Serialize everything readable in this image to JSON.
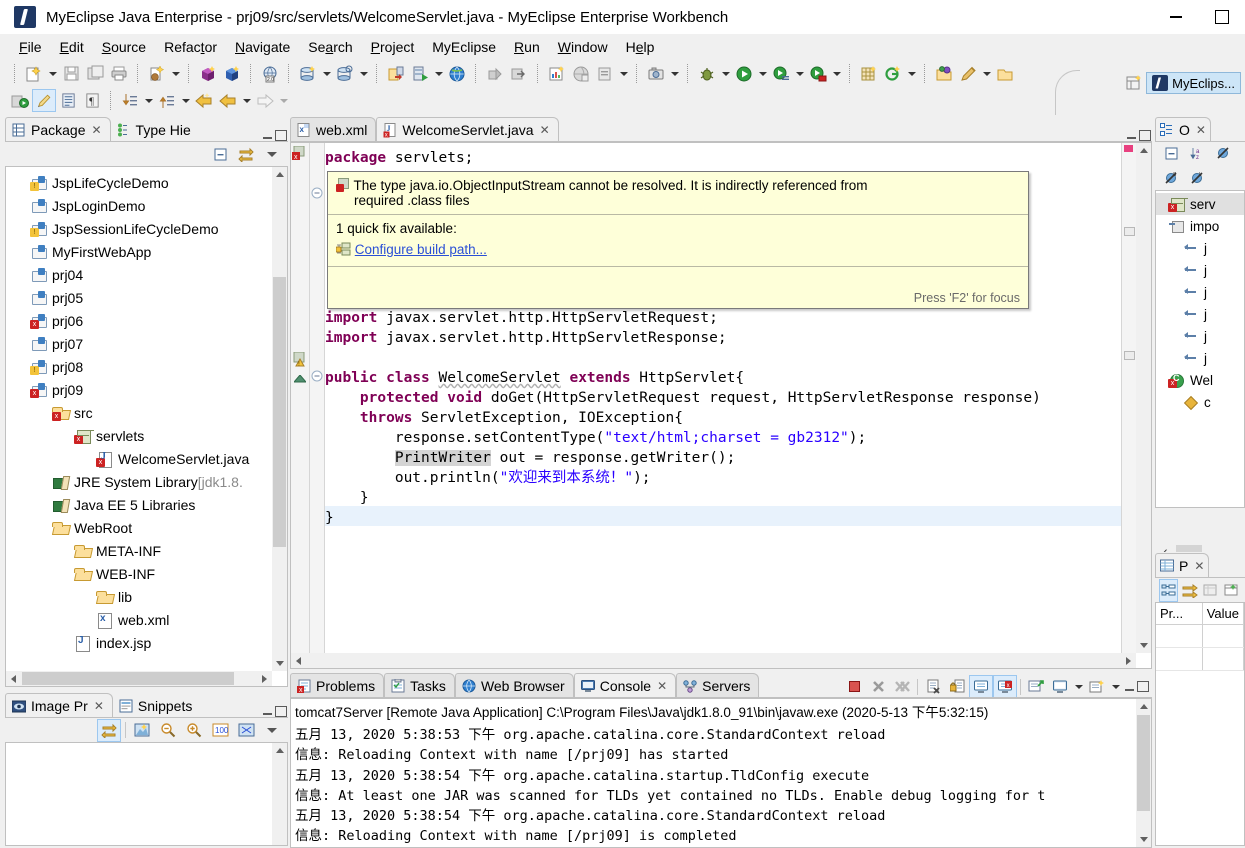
{
  "window": {
    "title": "MyEclipse Java Enterprise - prj09/src/servlets/WelcomeServlet.java - MyEclipse Enterprise Workbench",
    "app_icon": "myeclipse-icon",
    "minimize": "minimize-icon",
    "maximize": "maximize-icon"
  },
  "menubar": {
    "items": [
      {
        "label": "File"
      },
      {
        "label": "Edit"
      },
      {
        "label": "Source"
      },
      {
        "label": "Refactor"
      },
      {
        "label": "Navigate"
      },
      {
        "label": "Search"
      },
      {
        "label": "Project"
      },
      {
        "label": "MyEclipse"
      },
      {
        "label": "Run"
      },
      {
        "label": "Window"
      },
      {
        "label": "Help"
      }
    ]
  },
  "perspective": {
    "label": "MyEclips..."
  },
  "package_explorer": {
    "tabs": [
      {
        "label": "Package",
        "icon": "package-explorer-icon",
        "active": true,
        "closeable": true
      },
      {
        "label": "Type Hie",
        "icon": "type-hierarchy-icon",
        "active": false,
        "closeable": false
      }
    ],
    "tree": [
      {
        "label": "JspLifeCycleDemo",
        "icon": "project-icon",
        "badge": "warn",
        "indent": 0
      },
      {
        "label": "JspLoginDemo",
        "icon": "project-icon",
        "badge": "none",
        "indent": 0
      },
      {
        "label": "JspSessionLifeCycleDemo",
        "icon": "project-icon",
        "badge": "warn",
        "indent": 0
      },
      {
        "label": "MyFirstWebApp",
        "icon": "project-icon",
        "badge": "none",
        "indent": 0
      },
      {
        "label": "prj04",
        "icon": "project-icon",
        "badge": "none",
        "indent": 0
      },
      {
        "label": "prj05",
        "icon": "project-icon",
        "badge": "none",
        "indent": 0
      },
      {
        "label": "prj06",
        "icon": "project-icon",
        "badge": "err",
        "indent": 0
      },
      {
        "label": "prj07",
        "icon": "project-icon",
        "badge": "none",
        "indent": 0
      },
      {
        "label": "prj08",
        "icon": "project-icon",
        "badge": "warn",
        "indent": 0
      },
      {
        "label": "prj09",
        "icon": "project-icon",
        "badge": "err",
        "indent": 0
      },
      {
        "label": "src",
        "icon": "source-folder-icon",
        "badge": "err",
        "indent": 1
      },
      {
        "label": "servlets",
        "icon": "package-icon",
        "badge": "err",
        "indent": 2
      },
      {
        "label": "WelcomeServlet.java",
        "icon": "java-file-icon",
        "badge": "err",
        "indent": 3
      },
      {
        "label": "JRE System Library ",
        "suffix": "[jdk1.8.",
        "icon": "library-icon",
        "badge": "none",
        "indent": 1
      },
      {
        "label": "Java EE 5 Libraries",
        "icon": "library-icon",
        "badge": "none",
        "indent": 1
      },
      {
        "label": "WebRoot",
        "icon": "folder-open-icon",
        "badge": "none",
        "indent": 1
      },
      {
        "label": "META-INF",
        "icon": "folder-open-icon",
        "badge": "none",
        "indent": 2
      },
      {
        "label": "WEB-INF",
        "icon": "folder-open-icon",
        "badge": "none",
        "indent": 2
      },
      {
        "label": "lib",
        "icon": "folder-open-icon",
        "badge": "none",
        "indent": 3
      },
      {
        "label": "web.xml",
        "icon": "xml-file-icon",
        "badge": "none",
        "indent": 3
      },
      {
        "label": "index.jsp",
        "icon": "jsp-file-icon",
        "badge": "none",
        "indent": 2
      }
    ]
  },
  "image_preview": {
    "tabs": [
      {
        "label": "Image Pr",
        "icon": "image-preview-icon",
        "active": true,
        "closeable": true
      },
      {
        "label": "Snippets",
        "icon": "snippets-icon",
        "active": false,
        "closeable": false
      }
    ]
  },
  "editor": {
    "tabs": [
      {
        "label": "web.xml",
        "icon": "xml-file-icon",
        "active": false,
        "closeable": false
      },
      {
        "label": "WelcomeServlet.java",
        "icon": "java-file-icon",
        "active": true,
        "closeable": true
      }
    ],
    "code_lines": [
      "package servlets;",
      "",
      "",
      "",
      "",
      "",
      "",
      "import javax.servlet.http.HttpServletRequest;",
      "import javax.servlet.http.HttpServletResponse;",
      "",
      "public class WelcomeServlet extends HttpServlet{",
      "    protected void doGet(HttpServletRequest request, HttpServletResponse response)",
      "    throws ServletException, IOException{",
      "        response.setContentType(\"text/html;charset = gb2312\");",
      "        PrintWriter out = response.getWriter();",
      "        out.println(\"欢迎来到本系统！\");",
      "    }",
      "}"
    ],
    "hover": {
      "message_line1": "The type java.io.ObjectInputStream cannot be resolved. It is indirectly referenced from",
      "message_line2": "required .class files",
      "quickfix_count": "1 quick fix available:",
      "quickfix_label": "Configure build path...",
      "footer": "Press 'F2' for focus",
      "icon": "error-marker-icon"
    }
  },
  "outline": {
    "tabs": [
      {
        "label": "O",
        "icon": "outline-icon",
        "active": true,
        "closeable": true
      }
    ],
    "items": [
      {
        "label": "serv",
        "icon": "package-icon",
        "badge": "err",
        "indent": 0
      },
      {
        "label": "impo",
        "icon": "imports-icon",
        "badge": "none",
        "indent": 0
      },
      {
        "label": "j",
        "icon": "import-icon",
        "badge": "none",
        "indent": 1
      },
      {
        "label": "j",
        "icon": "import-icon",
        "badge": "none",
        "indent": 1
      },
      {
        "label": "j",
        "icon": "import-icon",
        "badge": "none",
        "indent": 1
      },
      {
        "label": "j",
        "icon": "import-icon",
        "badge": "none",
        "indent": 1
      },
      {
        "label": "j",
        "icon": "import-icon",
        "badge": "none",
        "indent": 1
      },
      {
        "label": "j",
        "icon": "import-icon",
        "badge": "none",
        "indent": 1
      },
      {
        "label": "Wel",
        "icon": "class-icon",
        "badge": "err",
        "indent": 0
      },
      {
        "label": "c",
        "icon": "method-icon",
        "badge": "none",
        "indent": 1
      }
    ]
  },
  "properties": {
    "tabs": [
      {
        "label": "P",
        "icon": "properties-icon",
        "active": true,
        "closeable": true
      }
    ],
    "columns": [
      "Pr...",
      "Value"
    ]
  },
  "bottom_panel": {
    "tabs": [
      {
        "label": "Problems",
        "icon": "problems-icon",
        "active": false,
        "closeable": false
      },
      {
        "label": "Tasks",
        "icon": "tasks-icon",
        "active": false,
        "closeable": false
      },
      {
        "label": "Web Browser",
        "icon": "web-browser-icon",
        "active": false,
        "closeable": false
      },
      {
        "label": "Console",
        "icon": "console-icon",
        "active": true,
        "closeable": true
      },
      {
        "label": "Servers",
        "icon": "servers-icon",
        "active": false,
        "closeable": false
      }
    ],
    "console_header": "tomcat7Server [Remote Java Application] C:\\Program Files\\Java\\jdk1.8.0_91\\bin\\javaw.exe (2020-5-13 下午5:32:15)",
    "console_lines": [
      "五月 13, 2020 5:38:53 下午 org.apache.catalina.core.StandardContext reload",
      "信息: Reloading Context with name [/prj09] has started",
      "五月 13, 2020 5:38:54 下午 org.apache.catalina.startup.TldConfig execute",
      "信息: At least one JAR was scanned for TLDs yet contained no TLDs. Enable debug logging for t",
      "五月 13, 2020 5:38:54 下午 org.apache.catalina.core.StandardContext reload",
      "信息: Reloading Context with name [/prj09] is completed"
    ]
  },
  "colors": {
    "chrome": "#f0f0f0",
    "panel_bg": "#ffffff",
    "accent_selected": "#cde5f7",
    "tooltip_bg": "#feffd9",
    "keyword": "#7f0055",
    "string": "#2a00ff",
    "link": "#2a4fd6",
    "error": "#cc2222",
    "warning": "#f3c33a"
  }
}
